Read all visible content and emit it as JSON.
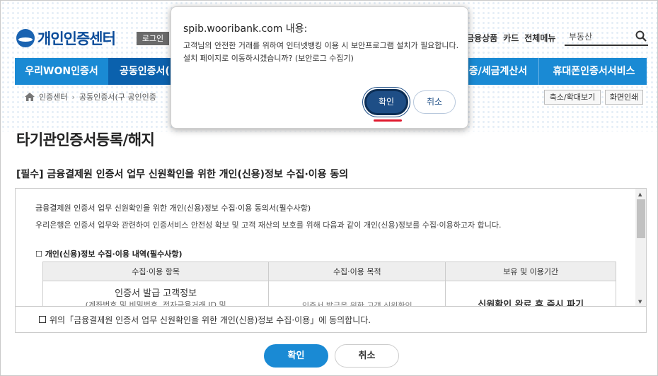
{
  "header": {
    "logo_text": "개인인증센터",
    "login_label": "로그인",
    "top_links": [
      "금융상품",
      "카드",
      "전체메뉴"
    ],
    "search_text": "부동산"
  },
  "nav": {
    "items": [
      "우리WON인증서",
      "공동인증서(",
      "증/세금계산서",
      "휴대폰인증서서비스"
    ]
  },
  "breadcrumb": {
    "items": [
      "인증센터",
      "공동인증서(구 공인인증"
    ],
    "zoom_label": "축소/확대보기",
    "print_label": "화면인쇄"
  },
  "page": {
    "title": "타기관인증서등록/해지",
    "section_title": "[필수] 금융결제원 인증서 업무 신원확인을 위한 개인(신용)정보 수집·이용 동의"
  },
  "consent": {
    "heading": "금융결제원 인증서 업무 신원확인을 위한 개인(신용)정보 수집·이용 동의서(필수사항)",
    "paragraph": "우리은행은 인증서 업무와 관련하여 인증서비스 안전성 확보 및 고객 재산의 보호를 위해 다음과 같이 개인(신용)정보를 수집·이용하고자 합니다.",
    "sub_heading": "☐ 개인(신용)정보 수집·이용 내역(필수사항)",
    "table_headers": [
      "수집·이용 항목",
      "수집·이용 목적",
      "보유 및 이용기간"
    ],
    "row": {
      "item_line1": "인증서 발급 고객정보",
      "item_line2": "(계좌번호 및 비밀번호, 전자금융거래 ID 및",
      "purpose": "인증서 발급을 위한 고객 신원확인",
      "period": "신원확인 완료 후 즉시 파기"
    },
    "agree_text": "위의「금융결제원 인증서 업무 신원확인을 위한 개인(신용)정보 수집·이용」에 동의합니다."
  },
  "buttons": {
    "confirm": "확인",
    "cancel": "취소"
  },
  "dialog": {
    "title": "spib.wooribank.com 내용:",
    "message": "고객님의 안전한 거래를 위하여 인터넷뱅킹 이용 시 보안프로그램 설치가 필요합니다. 설치 페이지로 이동하시겠습니까? (보안로그 수집기)",
    "ok_label": "확인",
    "cancel_label": "취소"
  },
  "colors": {
    "nav_blue": "#1a8ad4",
    "nav_active": "#0b61ad",
    "dialog_ok": "#1e4e86",
    "highlight_red": "#e0182d"
  }
}
